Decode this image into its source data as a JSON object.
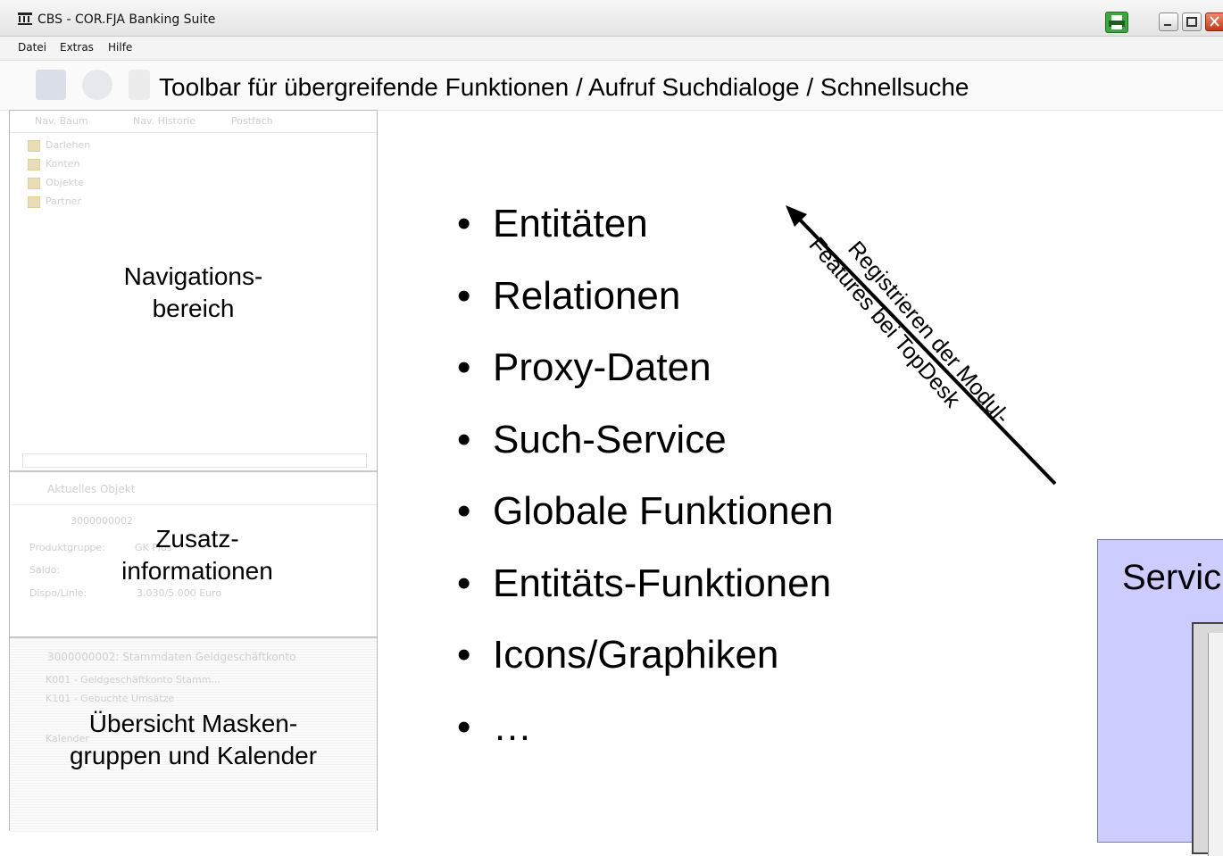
{
  "window": {
    "title": "CBS - COR.FJA Banking Suite"
  },
  "menu": [
    "Datei",
    "Extras",
    "Hilfe"
  ],
  "toolbar": {
    "label": "Toolbar für übergreifende Funktionen / Aufruf Suchdialoge / Schnellsuche"
  },
  "nav_panel": {
    "tabs": [
      "Nav. Baum",
      "Nav. Historie",
      "Postfach"
    ],
    "tree": [
      "Darlehen",
      "Konten",
      "Objekte",
      "Partner"
    ],
    "label_line1": "Navigations-",
    "label_line2": "bereich"
  },
  "info_panel": {
    "header": "Aktuelles Objekt",
    "object_id": "3000000002",
    "rows": [
      {
        "label": "Produktgruppe:",
        "value": "GK Plus"
      },
      {
        "label": "Saldo:",
        "value": ""
      },
      {
        "label": "Dispo/Linie:",
        "value": "3.030/5.000 Euro"
      }
    ],
    "label_line1": "Zusatz-",
    "label_line2": "informationen"
  },
  "overview_panel": {
    "header": "3000000002: Stammdaten Geldgeschäftkonto",
    "items": [
      "K001 - Geldgeschäftkonto Stamm...",
      "K101 - Gebuchte Umsätze"
    ],
    "calendar": "Kalender",
    "label_line1": "Übersicht Masken-",
    "label_line2": "gruppen und Kalender"
  },
  "bullets": [
    "Entitäten",
    "Relationen",
    "Proxy-Daten",
    "Such-Service",
    "Globale Funktionen",
    "Entitäts-Funktionen",
    "Icons/Graphiken",
    "…"
  ],
  "bullet_symbol": "•",
  "arrow_note": {
    "line1": "Registrieren der Modul-",
    "line2": "Features bei TopDesk"
  },
  "service_box": {
    "label": "Servic"
  },
  "colors": {
    "service_box": "#ccccff",
    "print_button": "#3aa83a"
  }
}
